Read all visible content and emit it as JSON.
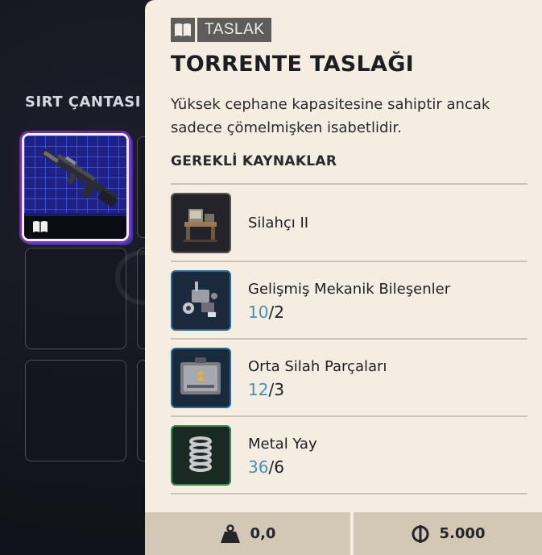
{
  "inventory": {
    "section_title": "SIRT ÇANTASI"
  },
  "item": {
    "tag_icon": "book-icon",
    "tag_label": "TASLAK",
    "title": "TORRENTE TASLAĞI",
    "description": "Yüksek cephane kapasitesine sahiptir ancak sadece çömelmişken isabetlidir.",
    "requirements_title": "GEREKLİ KAYNAKLAR",
    "requirements": [
      {
        "name": "Silahçı II",
        "icon": "workbench-icon",
        "have": "",
        "need": "",
        "sep": ""
      },
      {
        "name": "Gelişmiş Mekanik Bileşenler",
        "icon": "mechanical-parts-icon",
        "have": "10",
        "need": "2",
        "sep": "/"
      },
      {
        "name": "Orta Silah Parçaları",
        "icon": "weapon-parts-case-icon",
        "have": "12",
        "need": "3",
        "sep": "/"
      },
      {
        "name": "Metal Yay",
        "icon": "spring-icon",
        "have": "36",
        "need": "6",
        "sep": "/"
      }
    ],
    "weight": "0,0",
    "price": "5.000"
  },
  "colors": {
    "panel_bg": "#f6ede2",
    "footer_bg": "#d3c7b6",
    "quantity_have": "#4a8fb6",
    "blueprint_slot": "#1e2186"
  }
}
